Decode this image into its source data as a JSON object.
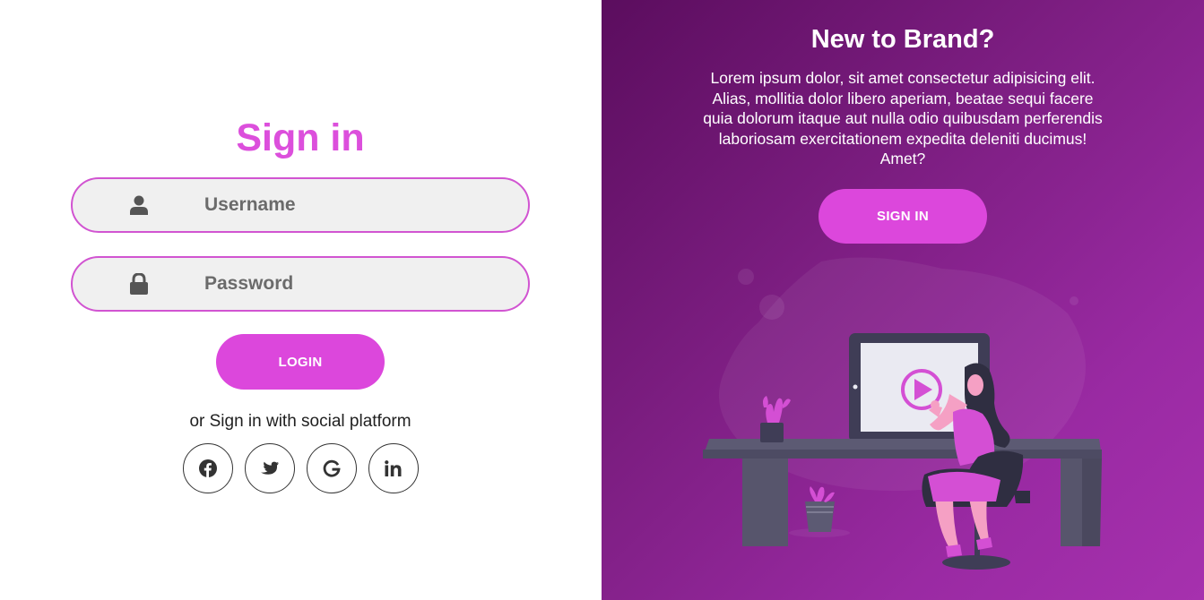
{
  "signin": {
    "title": "Sign in",
    "username_placeholder": "Username",
    "password_placeholder": "Password",
    "login_label": "LOGIN",
    "social_text": "or Sign in with social platform",
    "socials": [
      "facebook-icon",
      "twitter-icon",
      "google-icon",
      "linkedin-icon"
    ]
  },
  "promo": {
    "title": "New to Brand?",
    "text": "Lorem ipsum dolor, sit amet consectetur adipisicing elit. Alias, mollitia dolor libero aperiam, beatae sequi facere quia dolorum itaque aut nulla odio quibusdam perferendis laboriosam exercitationem expedita deleniti ducimus! Amet?",
    "button_label": "SIGN IN"
  },
  "colors": {
    "accent": "#dc47dc",
    "panel_dark": "#5b0d5e",
    "panel_light": "#a631ae"
  }
}
